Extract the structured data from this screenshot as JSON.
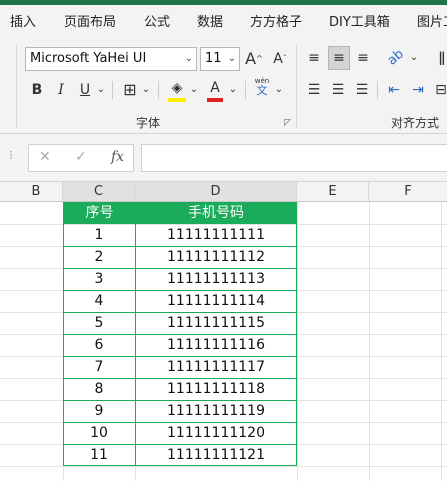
{
  "ribbon_tabs": [
    "插入",
    "页面布局",
    "公式",
    "数据",
    "方方格子",
    "DIY工具箱",
    "图片工"
  ],
  "font": {
    "family_value": "Microsoft YaHei UI",
    "size_value": "11",
    "increase_label": "A",
    "decrease_label": "A",
    "bold": "B",
    "italic": "I",
    "underline": "U",
    "font_color_letter": "A",
    "phonetic_top": "wén",
    "phonetic_bottom": "文",
    "group_label": "字体"
  },
  "alignment": {
    "group_label": "对齐方式",
    "wrap_label": "ab"
  },
  "formula_bar": {
    "cancel": "✕",
    "enter": "✓",
    "fx": "fx",
    "value": ""
  },
  "columns": [
    "B",
    "C",
    "D",
    "E",
    "F"
  ],
  "table": {
    "headers": [
      "序号",
      "手机号码"
    ],
    "rows": [
      [
        "1",
        "11111111111"
      ],
      [
        "2",
        "11111111112"
      ],
      [
        "3",
        "11111111113"
      ],
      [
        "4",
        "11111111114"
      ],
      [
        "5",
        "11111111115"
      ],
      [
        "6",
        "11111111116"
      ],
      [
        "7",
        "11111111117"
      ],
      [
        "8",
        "11111111118"
      ],
      [
        "9",
        "11111111119"
      ],
      [
        "10",
        "11111111120"
      ],
      [
        "11",
        "11111111121"
      ]
    ]
  },
  "colors": {
    "accent_green": "#1aab5b",
    "fill_highlight": "#ffee00",
    "font_red": "#e02020"
  }
}
